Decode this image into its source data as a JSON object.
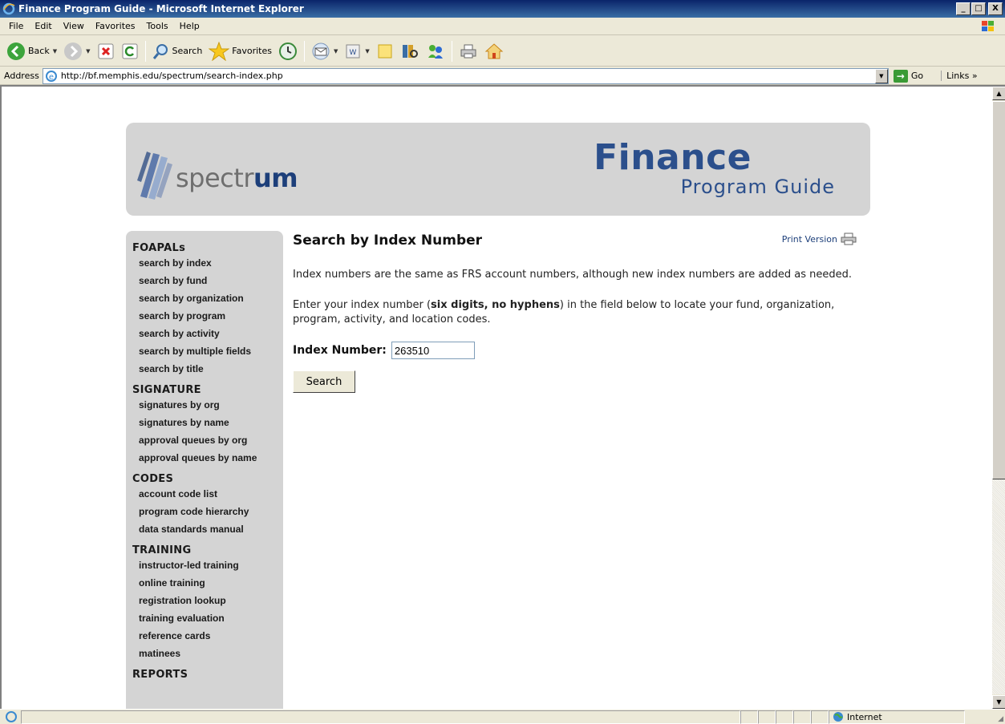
{
  "window": {
    "title": "Finance Program Guide - Microsoft Internet Explorer",
    "controls": {
      "minimize": "_",
      "maximize": "□",
      "close": "X"
    }
  },
  "menubar": {
    "items": [
      {
        "label": "File"
      },
      {
        "label": "Edit"
      },
      {
        "label": "View"
      },
      {
        "label": "Favorites"
      },
      {
        "label": "Tools"
      },
      {
        "label": "Help"
      }
    ]
  },
  "toolbar": {
    "back_label": "Back",
    "search_label": "Search",
    "favorites_label": "Favorites"
  },
  "address": {
    "label": "Address",
    "url": "http://bf.memphis.edu/spectrum/search-index.php",
    "go_label": "Go",
    "links_label": "Links »"
  },
  "banner": {
    "logo_plain": "spectr",
    "logo_bold": "um",
    "title": "Finance",
    "subtitle": "Program Guide"
  },
  "sidebar": {
    "sections": [
      {
        "heading": "FOAPALs",
        "links": [
          "search by index",
          "search by fund",
          "search by organization",
          "search by program",
          "search by activity",
          "search by multiple fields",
          "search by title"
        ]
      },
      {
        "heading": "SIGNATURE",
        "links": [
          "signatures by org",
          "signatures by name",
          "approval queues by org",
          "approval queues by name"
        ]
      },
      {
        "heading": "CODES",
        "links": [
          "account code list",
          "program code hierarchy",
          "data standards manual"
        ]
      },
      {
        "heading": "TRAINING",
        "links": [
          "instructor-led training",
          "online training",
          "registration lookup",
          "training evaluation",
          "reference cards",
          "matinees"
        ]
      },
      {
        "heading": "REPORTS",
        "links": []
      }
    ]
  },
  "main": {
    "heading": "Search by Index Number",
    "print_version": "Print Version",
    "para1": "Index numbers are the same as FRS account numbers, although new index numbers are added as needed.",
    "para2_before": "Enter your index number (",
    "para2_bold": "six digits, no hyphens",
    "para2_after": ") in the field below to locate your fund, organization, program, activity, and location codes.",
    "index_label": "Index Number:",
    "index_value": "263510",
    "search_button": "Search"
  },
  "statusbar": {
    "zone": "Internet"
  }
}
